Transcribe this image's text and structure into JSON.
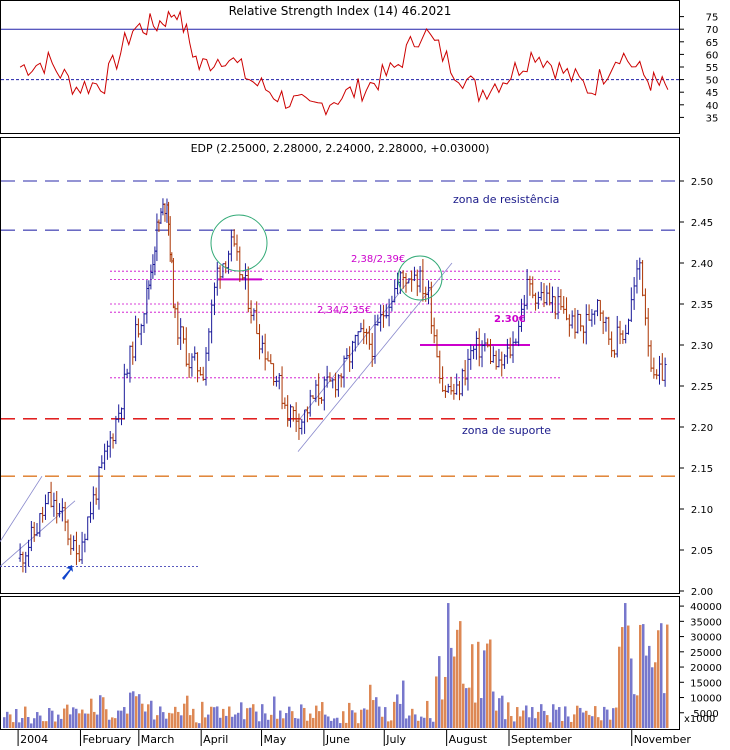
{
  "chart_data": [
    {
      "panel": "rsi",
      "type": "line",
      "title": "Relative Strength Index (14) 46.2021",
      "ylim": [
        30,
        80
      ],
      "yticks": [
        35,
        40,
        45,
        50,
        55,
        60,
        65,
        70,
        75
      ],
      "reference_lines": [
        70,
        50
      ],
      "series": [
        {
          "color": "#cc0000",
          "x": [
            "2004-01-02",
            "2004-01-16",
            "2004-01-30",
            "2004-02-13",
            "2004-02-27",
            "2004-03-10",
            "2004-03-20",
            "2004-03-31",
            "2004-04-13",
            "2004-04-27",
            "2004-05-11",
            "2004-05-25",
            "2004-06-08",
            "2004-06-22",
            "2004-07-06",
            "2004-07-20",
            "2004-08-03",
            "2004-08-17",
            "2004-08-31",
            "2004-09-14",
            "2004-09-28",
            "2004-10-12",
            "2004-10-26",
            "2004-11-09",
            "2004-11-19"
          ],
          "values": [
            55,
            57,
            47,
            49,
            70,
            72,
            78,
            55,
            60,
            49,
            43,
            38,
            43,
            47,
            54,
            70,
            56,
            45,
            51,
            61,
            53,
            46,
            61,
            50,
            46
          ]
        }
      ]
    },
    {
      "panel": "price",
      "type": "bar",
      "title": "EDP (2.25000, 2.28000, 2.24000, 2.28000, +0.03000)",
      "ylim": [
        2.0,
        2.55
      ],
      "yticks": [
        "2.00",
        "2.05",
        "2.10",
        "2.15",
        "2.20",
        "2.25",
        "2.30",
        "2.35",
        "2.40",
        "2.45",
        "2.50"
      ],
      "x_tick_labels": [
        "2004",
        "February",
        "March",
        "April",
        "May",
        "June",
        "July",
        "August",
        "September",
        "November"
      ],
      "series": [
        {
          "name": "close",
          "x": [
            "2004-01-02",
            "2004-01-09",
            "2004-01-16",
            "2004-01-23",
            "2004-01-30",
            "2004-02-06",
            "2004-02-13",
            "2004-02-20",
            "2004-02-27",
            "2004-03-05",
            "2004-03-10",
            "2004-03-15",
            "2004-03-19",
            "2004-03-26",
            "2004-04-02",
            "2004-04-09",
            "2004-04-16",
            "2004-04-23",
            "2004-04-30",
            "2004-05-07",
            "2004-05-14",
            "2004-05-21",
            "2004-05-28",
            "2004-06-04",
            "2004-06-11",
            "2004-06-18",
            "2004-06-25",
            "2004-07-02",
            "2004-07-09",
            "2004-07-16",
            "2004-07-23",
            "2004-07-30",
            "2004-08-06",
            "2004-08-13",
            "2004-08-20",
            "2004-08-27",
            "2004-09-03",
            "2004-09-10",
            "2004-09-17",
            "2004-09-24",
            "2004-10-01",
            "2004-10-08",
            "2004-10-15",
            "2004-10-22",
            "2004-10-29",
            "2004-11-05",
            "2004-11-12",
            "2004-11-19"
          ],
          "values": [
            2.04,
            2.07,
            2.11,
            2.09,
            2.04,
            2.1,
            2.16,
            2.22,
            2.3,
            2.36,
            2.44,
            2.48,
            2.33,
            2.28,
            2.27,
            2.39,
            2.42,
            2.37,
            2.31,
            2.27,
            2.22,
            2.21,
            2.24,
            2.25,
            2.27,
            2.31,
            2.3,
            2.35,
            2.38,
            2.39,
            2.36,
            2.25,
            2.24,
            2.29,
            2.3,
            2.27,
            2.3,
            2.37,
            2.36,
            2.35,
            2.33,
            2.32,
            2.36,
            2.3,
            2.32,
            2.4,
            2.25,
            2.28
          ]
        }
      ],
      "horizontal_lines": [
        {
          "value": 2.5,
          "style": "dashed",
          "color": "#5555bb"
        },
        {
          "value": 2.44,
          "style": "dashed",
          "color": "#5555bb"
        },
        {
          "value": 2.21,
          "style": "dashed",
          "color": "#dd0000"
        },
        {
          "value": 2.14,
          "style": "dashed",
          "color": "#dd7722"
        }
      ],
      "annotations": [
        {
          "text": "zona de resistência",
          "color": "#1a1a8a"
        },
        {
          "text": "zona de suporte",
          "color": "#1a1a8a"
        },
        {
          "text": "2,38/2,39€",
          "color": "#cc00cc"
        },
        {
          "text": "2,34/2,35€",
          "color": "#cc00cc"
        },
        {
          "text": "2.30€",
          "color": "#cc00cc"
        }
      ]
    },
    {
      "panel": "volume",
      "type": "bar",
      "ylim": [
        0,
        42000
      ],
      "yticks": [
        5000,
        10000,
        15000,
        20000,
        25000,
        30000,
        35000,
        40000
      ],
      "units_label": "x1000",
      "series": [
        {
          "name": "volume",
          "x": [
            "2004-01",
            "2004-02",
            "2004-03",
            "2004-04",
            "2004-05",
            "2004-06",
            "2004-07",
            "2004-08",
            "2004-09",
            "2004-10",
            "2004-11"
          ],
          "values": [
            8000,
            12000,
            14000,
            10000,
            9000,
            10000,
            12000,
            40000,
            12000,
            9000,
            39000
          ]
        }
      ]
    }
  ]
}
